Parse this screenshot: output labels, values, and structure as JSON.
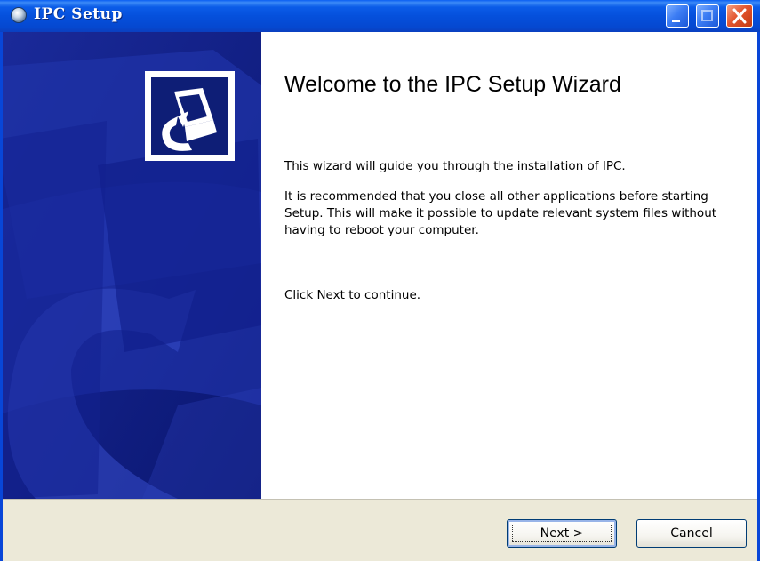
{
  "window": {
    "title": "IPC Setup",
    "controls": {
      "minimize": "minimize",
      "maximize": "maximize (disabled)",
      "close": "close"
    }
  },
  "wizard": {
    "heading": "Welcome to the IPC Setup Wizard",
    "paragraphs": [
      "This wizard will guide you through the installation of IPC.",
      "It is recommended that you close all other applications before starting Setup. This will make it possible to update relevant system files without having to reboot your computer.",
      "Click Next to continue."
    ]
  },
  "buttons": {
    "next_label": "Next >",
    "cancel_label": "Cancel"
  },
  "icons": {
    "title_icon": "installer-cd-icon",
    "header_icon": "computer-install-icon"
  },
  "colors": {
    "titlebar": "#0550dc",
    "sidebar": "#0f1f86",
    "footer": "#ece9d8",
    "close_button": "#e3552e"
  }
}
